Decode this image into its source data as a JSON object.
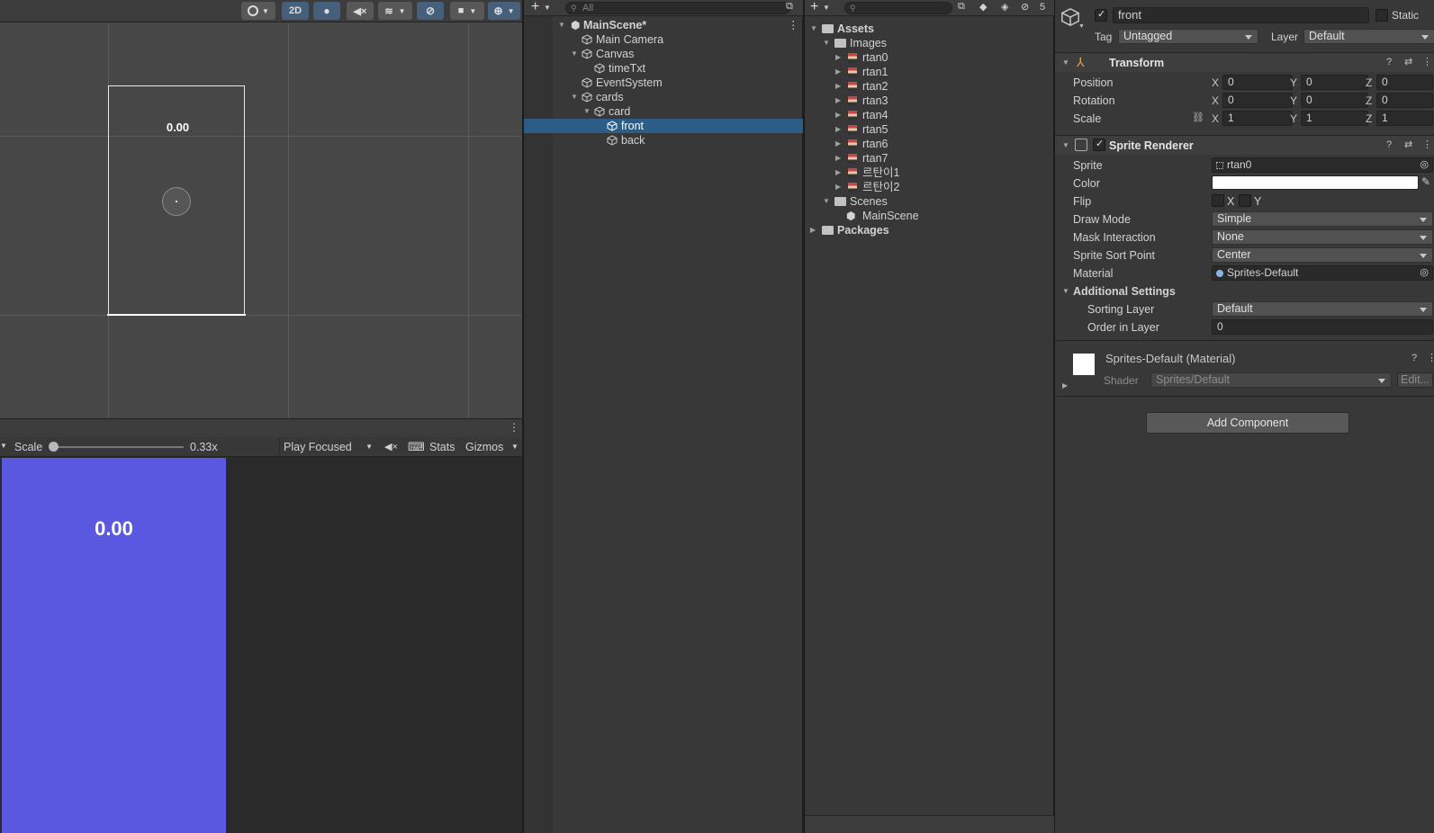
{
  "scene": {
    "toolbar_2d": "2D",
    "scene_label": "0.00"
  },
  "game": {
    "scale_label": "Scale",
    "scale_value": "0.33x",
    "play_mode": "Play Focused",
    "stats": "Stats",
    "gizmos": "Gizmos",
    "canvas_text": "0.00",
    "canvas_color": "#5a57e0"
  },
  "hierarchy": {
    "search_placeholder": "All",
    "items": [
      {
        "label": "MainScene*"
      },
      {
        "label": "Main Camera"
      },
      {
        "label": "Canvas"
      },
      {
        "label": "timeTxt"
      },
      {
        "label": "EventSystem"
      },
      {
        "label": "cards"
      },
      {
        "label": "card"
      },
      {
        "label": "front"
      },
      {
        "label": "back"
      }
    ]
  },
  "project": {
    "hidden_count": "5",
    "items": [
      {
        "label": "Assets"
      },
      {
        "label": "Images"
      },
      {
        "label": "rtan0"
      },
      {
        "label": "rtan1"
      },
      {
        "label": "rtan2"
      },
      {
        "label": "rtan3"
      },
      {
        "label": "rtan4"
      },
      {
        "label": "rtan5"
      },
      {
        "label": "rtan6"
      },
      {
        "label": "rtan7"
      },
      {
        "label": "르탄이1"
      },
      {
        "label": "르탄이2"
      },
      {
        "label": "Scenes"
      },
      {
        "label": "MainScene"
      },
      {
        "label": "Packages"
      }
    ]
  },
  "inspector": {
    "object_name": "front",
    "static_label": "Static",
    "tag_label": "Tag",
    "tag_value": "Untagged",
    "layer_label": "Layer",
    "layer_value": "Default",
    "transform": {
      "title": "Transform",
      "position_label": "Position",
      "rotation_label": "Rotation",
      "scale_label": "Scale",
      "position": {
        "x": "0",
        "y": "0",
        "z": "0"
      },
      "rotation": {
        "x": "0",
        "y": "0",
        "z": "0"
      },
      "scale": {
        "x": "1",
        "y": "1",
        "z": "1"
      },
      "axis_x": "X",
      "axis_y": "Y",
      "axis_z": "Z"
    },
    "sprite_renderer": {
      "title": "Sprite Renderer",
      "sprite_label": "Sprite",
      "sprite_value": "rtan0",
      "color_label": "Color",
      "color_value": "#ffffff",
      "flip_label": "Flip",
      "flip_x": "X",
      "flip_y": "Y",
      "draw_mode_label": "Draw Mode",
      "draw_mode_value": "Simple",
      "mask_label": "Mask Interaction",
      "mask_value": "None",
      "sort_point_label": "Sprite Sort Point",
      "sort_point_value": "Center",
      "material_label": "Material",
      "material_value": "Sprites-Default",
      "additional_label": "Additional Settings",
      "sorting_layer_label": "Sorting Layer",
      "sorting_layer_value": "Default",
      "order_label": "Order in Layer",
      "order_value": "0"
    },
    "material": {
      "title": "Sprites-Default (Material)",
      "shader_label": "Shader",
      "shader_value": "Sprites/Default",
      "edit_label": "Edit..."
    },
    "add_component": "Add Component"
  }
}
